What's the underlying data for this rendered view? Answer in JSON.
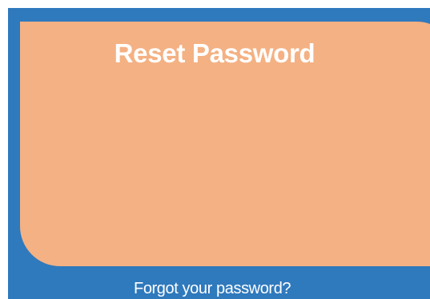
{
  "reset_card": {
    "title": "Reset Password"
  },
  "footer": {
    "forgot_link": "Forgot your password?"
  },
  "colors": {
    "page_background": "#2f79bd",
    "card_background": "#f4b183",
    "text": "#ffffff"
  }
}
